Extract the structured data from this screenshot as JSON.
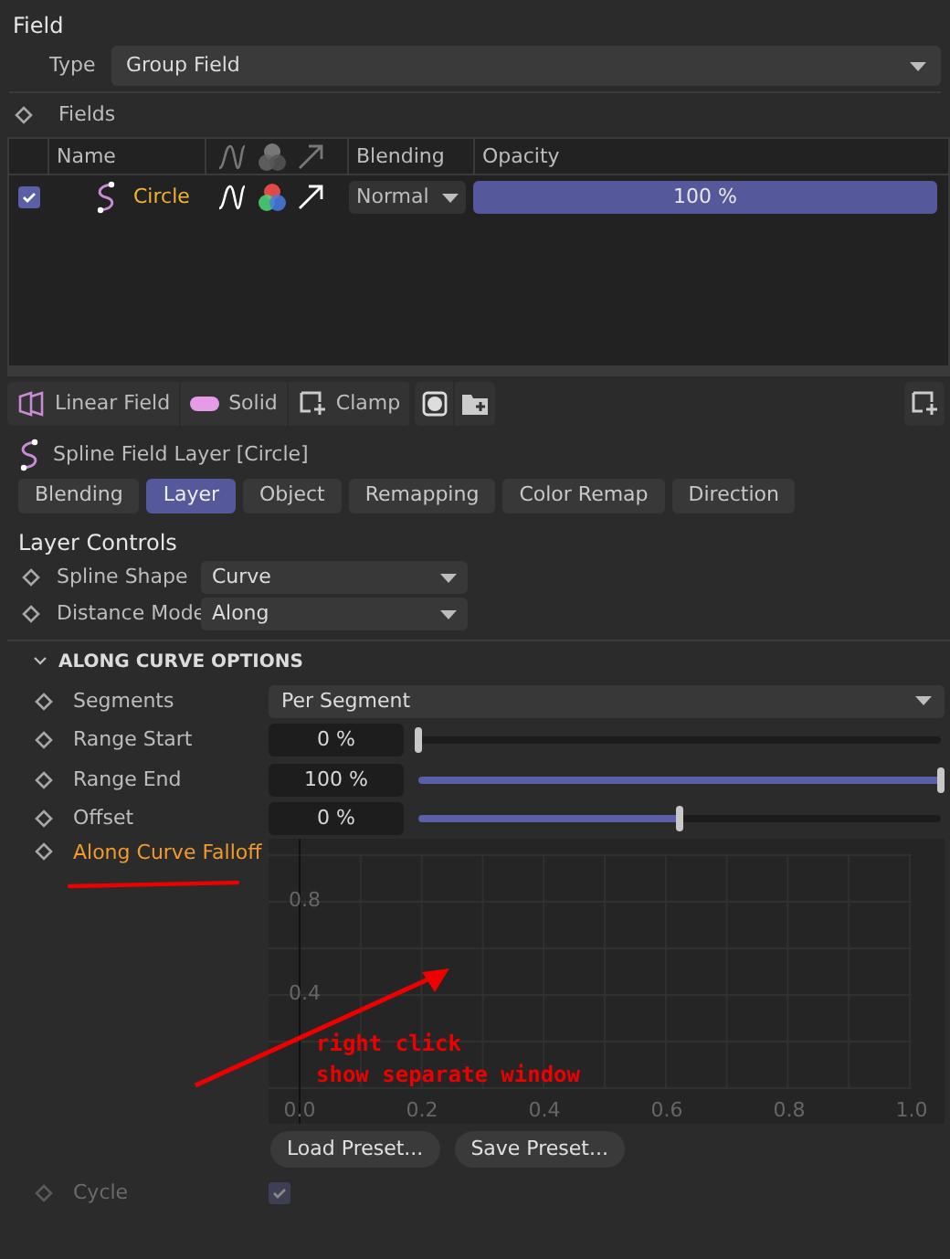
{
  "header": {
    "title": "Field",
    "type_label": "Type",
    "type_value": "Group Field"
  },
  "fields": {
    "label": "Fields",
    "columns": [
      "Name",
      "Blending",
      "Opacity"
    ],
    "rows": [
      {
        "checked": true,
        "name": "Circle",
        "blending": "Normal",
        "opacity": "100 %",
        "level": 1
      }
    ]
  },
  "toolbar": {
    "buttons": [
      {
        "kind": "linear",
        "label": "Linear Field"
      },
      {
        "kind": "solid",
        "label": "Solid"
      },
      {
        "kind": "clamp",
        "label": "Clamp"
      }
    ]
  },
  "layer": {
    "title": "Spline Field Layer [Circle]",
    "tabs": [
      {
        "label": "Blending",
        "selected": false
      },
      {
        "label": "Layer",
        "selected": true
      },
      {
        "label": "Object",
        "selected": false
      },
      {
        "label": "Remapping",
        "selected": false
      },
      {
        "label": "Color Remap",
        "selected": false
      },
      {
        "label": "Direction",
        "selected": false
      }
    ]
  },
  "controls": {
    "title": "Layer Controls",
    "rows": [
      {
        "label": "Spline Shape",
        "value": "Curve"
      },
      {
        "label": "Distance Mode",
        "value": "Along"
      }
    ]
  },
  "along": {
    "title": "ALONG CURVE OPTIONS",
    "expanded": true,
    "rows": [
      {
        "kind": "dropdown",
        "label": "Segments",
        "value": "Per Segment"
      },
      {
        "kind": "slider",
        "label": "Range Start",
        "value": "0 %",
        "level": 0
      },
      {
        "kind": "slider",
        "label": "Range End",
        "value": "100 %",
        "level": 1
      },
      {
        "kind": "slider",
        "label": "Offset",
        "value": "0 %",
        "level": 0.5
      }
    ],
    "falloff": {
      "label": "Along Curve Falloff",
      "y_labels": [
        "0.8",
        "0.4"
      ],
      "x_labels": [
        "0.0",
        "0.2",
        "0.4",
        "0.6",
        "0.8",
        "1.0"
      ]
    },
    "presets": [
      "Load Preset...",
      "Save Preset..."
    ],
    "cycle": {
      "label": "Cycle",
      "checked": true,
      "disabled": true
    }
  },
  "annotation": {
    "lines": [
      "right click",
      "show separate window"
    ]
  }
}
